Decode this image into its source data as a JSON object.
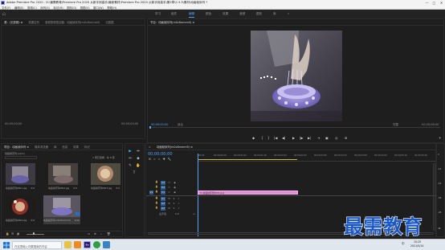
{
  "window": {
    "title": "Adobe Premiere Pro 2020 - D:\\最需教育\\Premiere Pro 2020 从新手到高手\\最新素材\\Premiere Pro 2020 从新手到高手\\第2章\\2.3.5\\素材\\动画帧序列 *",
    "minimize": "—",
    "maximize": "□",
    "close": "✕"
  },
  "menu": [
    "文件(F)",
    "编辑(E)",
    "剪辑(C)",
    "序列(S)",
    "标记(M)",
    "图形(G)",
    "视图(V)",
    "窗口(W)",
    "帮助(H)"
  ],
  "workspaces": {
    "items": [
      "学习",
      "组件",
      "编辑",
      "颜色",
      "效果",
      "音频",
      "图形",
      "库"
    ],
    "active": "编辑",
    "more": "»"
  },
  "source_panel": {
    "tabs": [
      "源：(无剪辑) ≡",
      "效果控件",
      "音频剪辑混合器：动画帧序列(m0c8mmm9)",
      "元数据"
    ],
    "timecode_left": "00;00;00;00",
    "timecode_right": "00;00;00;00"
  },
  "program_panel": {
    "tab": "节目：动画帧序列(m0c8mmm9) ≡",
    "timecode_current": "00;00;00;00",
    "fit": "适合",
    "resolution": "完整",
    "timecode_duration": "00;00;06;00"
  },
  "transport": [
    "◆",
    "{",
    "}",
    "|◀",
    "◀|",
    "▶",
    "|▶",
    "▶|",
    "⇥",
    "▣",
    "◎",
    "⊞",
    "+"
  ],
  "project_panel": {
    "tabs": [
      "项目：动画帧序列 ≡",
      "媒体浏览器",
      "库",
      "信息",
      "效果",
      "标记"
    ],
    "project_file": "动画帧序列.prproj",
    "item_count": "1 项已选择，共 6 项",
    "items": [
      {
        "label": "动画帧序列0001.jpg",
        "duration": "0;0"
      },
      {
        "label": "动画帧序列0002.jpg",
        "duration": "0;0"
      },
      {
        "label": "动画帧序列0003.jpg",
        "duration": "0;0"
      },
      {
        "label": "动画帧序列0004.jpg",
        "duration": "0;0"
      },
      {
        "label": "动画帧序列(m0c8mmm9)",
        "duration": "6;00"
      }
    ]
  },
  "tools": [
    "▶",
    "⇹",
    "⇔",
    "◆",
    "✎",
    "✋",
    "T"
  ],
  "timeline": {
    "tab": "动画帧序列(m0c8mmm9) ≡",
    "timecode": "00;00;00;00",
    "ruler": [
      ";00;00",
      "00;00;00;16",
      "00;00;01;02",
      "00;00;01;18",
      "00;00;02;04",
      "00;00;02;20",
      "00;00;03;06",
      "00;00;03;22",
      "00;00;04;08",
      "00;00;04;24",
      "00;00;05;10",
      "00;00;05;26"
    ],
    "video_tracks": [
      "V3",
      "V2",
      "V1"
    ],
    "audio_tracks": [
      "A1",
      "A2",
      "A3"
    ],
    "source_patch": "V1",
    "master": "主声道",
    "master_value": "0.0",
    "clip_label": "fx 动画帧序列0001.jpg",
    "btn_lock": "🔒",
    "btn_sync": "▭",
    "btn_eye": "◉",
    "btn_mute": "M",
    "btn_solo": "S",
    "btn_mic": "♪"
  },
  "meters": [
    "0",
    "-12",
    "-24",
    "-36",
    "-48",
    "dB"
  ],
  "taskbar": {
    "search_placeholder": "在这里输入你要搜索的内容",
    "tooltip": "Pr",
    "time": "10:25",
    "date": "2021/5/14",
    "lang": "中"
  },
  "watermark": "最需教育",
  "colors": {
    "accent_blue": "#4ea3ff",
    "clip_pink": "#e389d6",
    "track_blue": "#2e5a8c"
  }
}
